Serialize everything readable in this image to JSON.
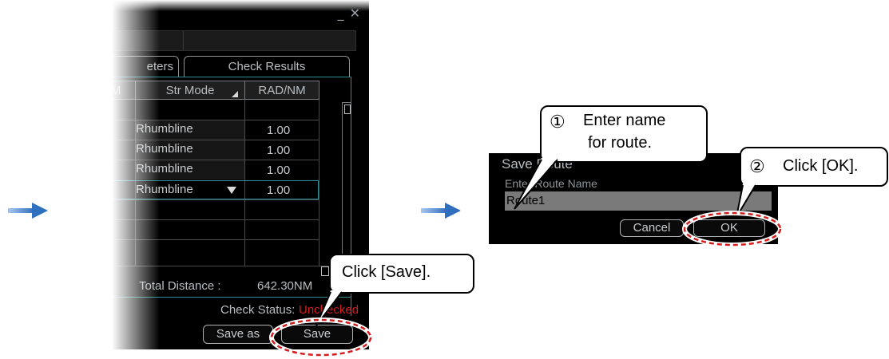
{
  "window": {
    "controls": "_ ✕",
    "tabs": {
      "parameters": "eters",
      "check_results": "Check Results"
    },
    "table": {
      "headers": {
        "partial": "M",
        "str_mode": "Str Mode",
        "rad_nm": "RAD/NM"
      },
      "rows": [
        {
          "str_mode": "Rhumbline",
          "rad_nm": "1.00"
        },
        {
          "str_mode": "Rhumbline",
          "rad_nm": "1.00"
        },
        {
          "str_mode": "Rhumbline",
          "rad_nm": "1.00"
        },
        {
          "str_mode": "Rhumbline",
          "rad_nm": "1.00",
          "selected": true
        }
      ]
    },
    "total_distance_label": "Total Distance :",
    "total_distance_value": "642.30NM",
    "check_status_label": "Check Status:",
    "check_status_value": "Unchecked",
    "buttons": {
      "save_as": "Save as",
      "save": "Save"
    }
  },
  "dialog": {
    "title": "Save Route",
    "prompt": "Enter Route Name",
    "route_name_value": "Route1",
    "buttons": {
      "cancel": "Cancel",
      "ok": "OK"
    }
  },
  "callouts": {
    "save": "Click [Save].",
    "step1_number": "①",
    "step1_text_line1": "Enter name",
    "step1_text_line2": "for route.",
    "step2_number": "②",
    "step2_text": "Click [OK]."
  },
  "colors": {
    "flow_arrow": "#2f6fbe",
    "teal_frame": "#2e8e94",
    "highlight_ellipse": "#d21e1e",
    "status_unchecked": "#d21e1e"
  },
  "icons": [
    "flow-arrow-icon",
    "close-icon",
    "minimize-icon",
    "sort-icon",
    "dropdown-icon"
  ]
}
